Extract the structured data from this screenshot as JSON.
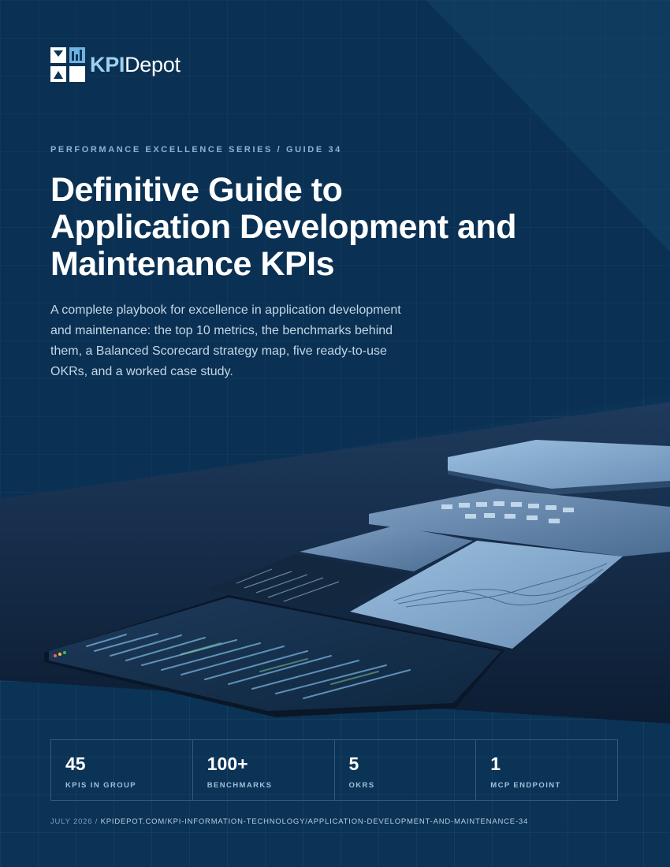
{
  "brand": {
    "kpi": "KPI",
    "depot": "Depot"
  },
  "series_label": "PERFORMANCE EXCELLENCE SERIES / GUIDE 34",
  "title_lines": [
    "Definitive Guide to",
    "Application Development and",
    "Maintenance KPIs"
  ],
  "subtitle": "A complete playbook for excellence in application development and maintenance: the top 10 metrics, the benchmarks behind them, a Balanced Scorecard strategy map, five ready-to-use OKRs, and a worked case study.",
  "stats": [
    {
      "value": "45",
      "label": "KPIS IN GROUP"
    },
    {
      "value": "100+",
      "label": "BENCHMARKS"
    },
    {
      "value": "5",
      "label": "OKRS"
    },
    {
      "value": "1",
      "label": "MCP ENDPOINT"
    }
  ],
  "footer": {
    "date": "JULY 2026",
    "separator": " / ",
    "url": "KPIDEPOT.COM/KPI-INFORMATION-TECHNOLOGY/APPLICATION-DEVELOPMENT-AND-MAINTENANCE-34"
  },
  "colors": {
    "background": "#0b3356",
    "accent": "#9fd0f0",
    "text": "#ffffff"
  }
}
